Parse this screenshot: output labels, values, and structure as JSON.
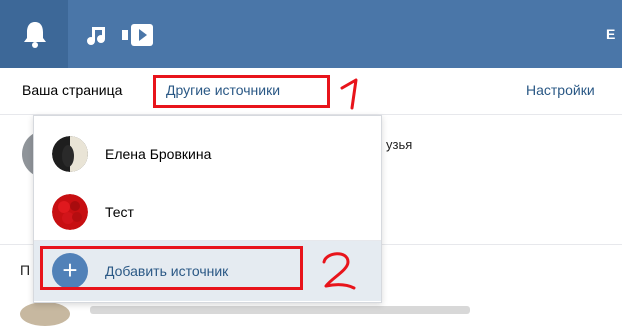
{
  "topbar": {
    "icons": [
      "bell-icon",
      "music-icon",
      "video-icon"
    ],
    "right_letter": "E"
  },
  "subnav": {
    "your_page": "Ваша страница",
    "other_sources": "Другие источники",
    "settings": "Настройки"
  },
  "feed": {
    "partial_text": "узья",
    "partial_letter": "П"
  },
  "dropdown": {
    "items": [
      {
        "label": "Елена Бровкина",
        "avatar": "photo-avatar"
      },
      {
        "label": "Тест",
        "avatar": "red-flower-avatar"
      }
    ],
    "add_label": "Добавить источник"
  },
  "annotations": {
    "marker_1": "1",
    "marker_2": "2",
    "color": "#e8141b"
  },
  "colors": {
    "header": "#4a76a8",
    "link": "#2a5885",
    "accent": "#5181b8"
  }
}
